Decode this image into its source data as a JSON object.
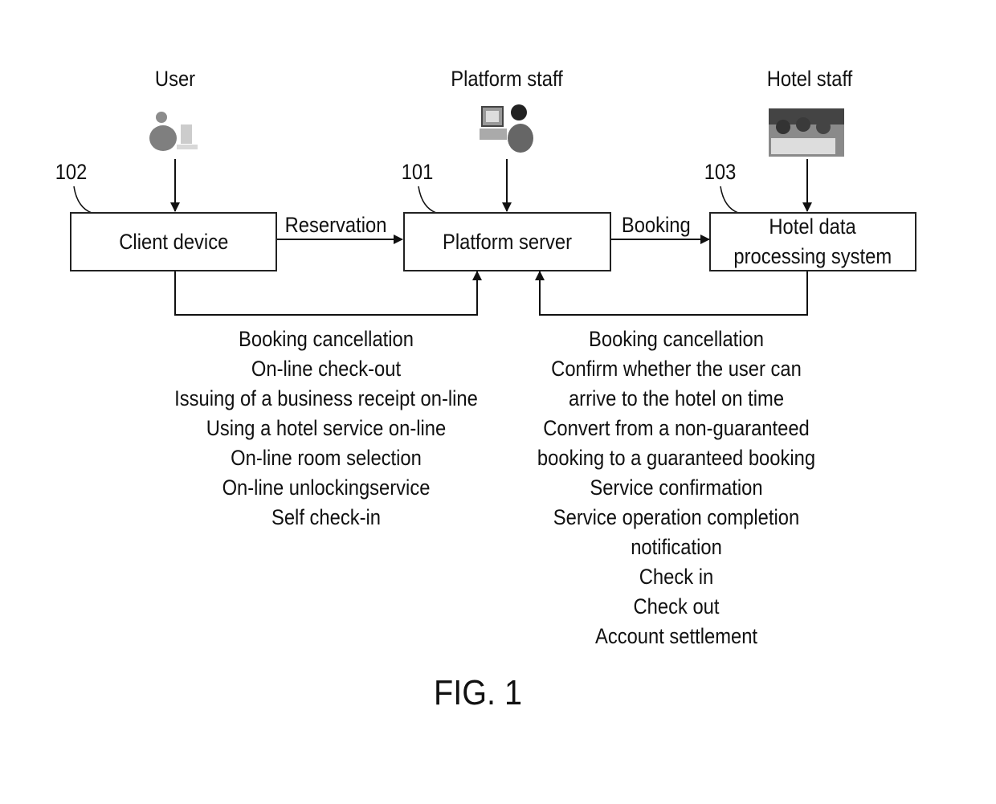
{
  "actors": {
    "user": {
      "label": "User",
      "icon": "user-at-computer-icon"
    },
    "platform_staff": {
      "label": "Platform staff",
      "icon": "staff-at-computer-icon"
    },
    "hotel_staff": {
      "label": "Hotel staff",
      "icon": "hotel-staff-photo-icon"
    }
  },
  "nodes": {
    "client": {
      "ref": "102",
      "label": "Client device"
    },
    "platform": {
      "ref": "101",
      "label": "Platform server"
    },
    "hotel": {
      "ref": "103",
      "label_line1": "Hotel data",
      "label_line2": "processing system"
    }
  },
  "edges": {
    "reservation": "Reservation",
    "booking": "Booking"
  },
  "client_functions": [
    "Booking cancellation",
    "On-line check-out",
    "Issuing of a business receipt on-line",
    "Using a hotel service on-line",
    "On-line room selection",
    "On-line unlockingservice",
    "Self check-in"
  ],
  "hotel_functions": [
    "Booking cancellation",
    "Confirm whether the user can",
    "arrive to the hotel on time",
    "Convert from a non-guaranteed",
    "booking to a guaranteed booking",
    "Service confirmation",
    "Service operation completion",
    "notification",
    "Check in",
    "Check out",
    "Account settlement"
  ],
  "figure_label": "FIG. 1"
}
